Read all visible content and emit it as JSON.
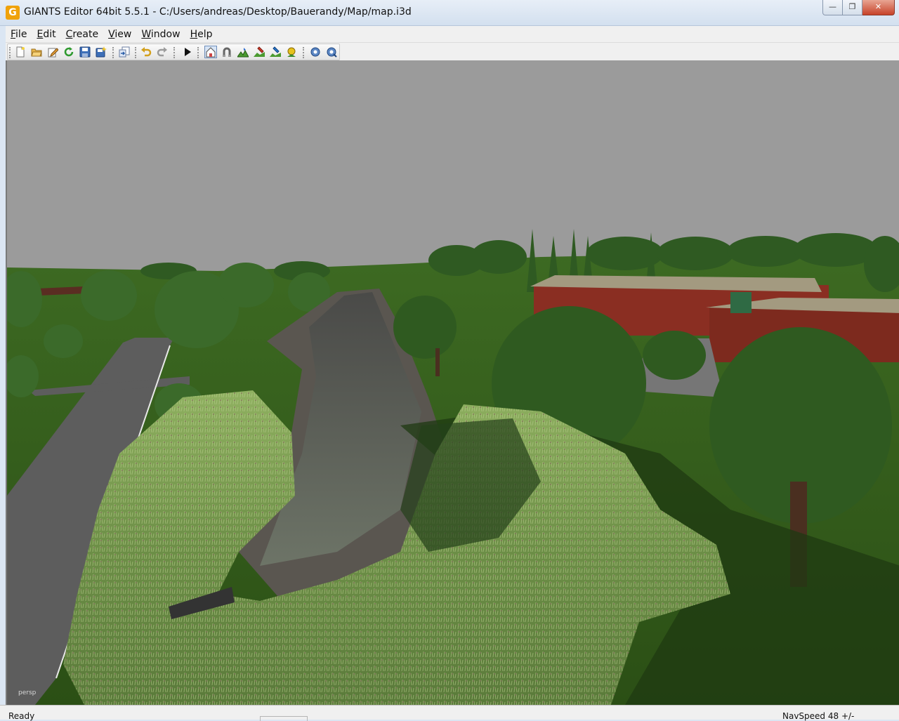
{
  "window": {
    "logo_letter": "G",
    "title": "GIANTS Editor 64bit 5.5.1 - C:/Users/andreas/Desktop/Bauerandy/Map/map.i3d",
    "controls": {
      "minimize": "—",
      "maximize": "❐",
      "close": "✕"
    }
  },
  "menubar": {
    "items": [
      {
        "access": "F",
        "rest": "ile"
      },
      {
        "access": "E",
        "rest": "dit"
      },
      {
        "access": "C",
        "rest": "reate"
      },
      {
        "access": "V",
        "rest": "iew"
      },
      {
        "access": "W",
        "rest": "indow"
      },
      {
        "access": "H",
        "rest": "elp"
      }
    ]
  },
  "toolbar": {
    "icons": [
      "new-file-icon",
      "open-folder-icon",
      "edit-icon",
      "refresh-icon",
      "save-icon",
      "save-as-icon",
      "import-icon",
      "undo-icon",
      "redo-icon",
      "play-icon",
      "select-home-icon",
      "magnet-icon",
      "terrain-sculpt-icon",
      "terrain-paint-icon",
      "foliage-paint-icon",
      "place-object-icon",
      "settings-icon",
      "settings-advanced-icon"
    ]
  },
  "viewport": {
    "camera_label": "persp",
    "sky_color": "#9b9b9b",
    "grass_color": "#3d6a22"
  },
  "statusbar": {
    "left": "Ready",
    "right": "NavSpeed 48 +/-"
  }
}
